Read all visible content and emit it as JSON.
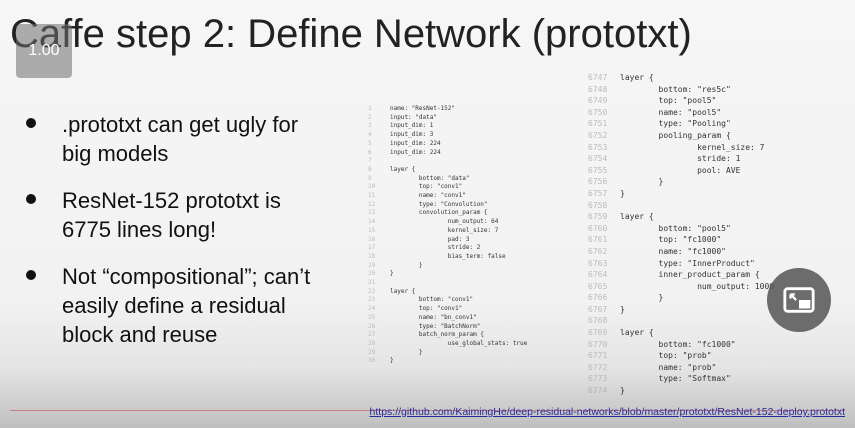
{
  "title": "Caffe step 2: Define Network (prototxt)",
  "video_overlay": {
    "speed_label": "1.00",
    "pip_icon": "picture-in-picture-icon"
  },
  "bullets": [
    {
      "lines": [
        ".prototxt can get ugly for",
        "big models"
      ]
    },
    {
      "lines": [
        "ResNet-152 prototxt is",
        "6775 lines long!"
      ]
    },
    {
      "lines": [
        "Not “compositional”; can’t",
        "easily define a residual",
        "block and reuse"
      ]
    }
  ],
  "code_left": [
    {
      "n": "1",
      "text": "name: \"ResNet-152\""
    },
    {
      "n": "2",
      "text": "input: \"data\""
    },
    {
      "n": "3",
      "text": "input_dim: 1"
    },
    {
      "n": "4",
      "text": "input_dim: 3"
    },
    {
      "n": "5",
      "text": "input_dim: 224"
    },
    {
      "n": "6",
      "text": "input_dim: 224"
    },
    {
      "n": "7",
      "text": ""
    },
    {
      "n": "8",
      "text": "layer {"
    },
    {
      "n": "9",
      "text": "        bottom: \"data\""
    },
    {
      "n": "10",
      "text": "        top: \"conv1\""
    },
    {
      "n": "11",
      "text": "        name: \"conv1\""
    },
    {
      "n": "12",
      "text": "        type: \"Convolution\""
    },
    {
      "n": "13",
      "text": "        convolution_param {"
    },
    {
      "n": "14",
      "text": "                num_output: 64"
    },
    {
      "n": "15",
      "text": "                kernel_size: 7"
    },
    {
      "n": "16",
      "text": "                pad: 3"
    },
    {
      "n": "17",
      "text": "                stride: 2"
    },
    {
      "n": "18",
      "text": "                bias_term: false"
    },
    {
      "n": "19",
      "text": "        }"
    },
    {
      "n": "20",
      "text": "}"
    },
    {
      "n": "21",
      "text": ""
    },
    {
      "n": "22",
      "text": "layer {"
    },
    {
      "n": "23",
      "text": "        bottom: \"conv1\""
    },
    {
      "n": "24",
      "text": "        top: \"conv1\""
    },
    {
      "n": "25",
      "text": "        name: \"bn_conv1\""
    },
    {
      "n": "26",
      "text": "        type: \"BatchNorm\""
    },
    {
      "n": "27",
      "text": "        batch_norm_param {"
    },
    {
      "n": "28",
      "text": "                use_global_stats: true"
    },
    {
      "n": "29",
      "text": "        }"
    },
    {
      "n": "30",
      "text": "}"
    }
  ],
  "code_right": [
    {
      "n": "6747",
      "text": "layer {"
    },
    {
      "n": "6748",
      "text": "        bottom: \"res5c\""
    },
    {
      "n": "6749",
      "text": "        top: \"pool5\""
    },
    {
      "n": "6750",
      "text": "        name: \"pool5\""
    },
    {
      "n": "6751",
      "text": "        type: \"Pooling\""
    },
    {
      "n": "6752",
      "text": "        pooling_param {"
    },
    {
      "n": "6753",
      "text": "                kernel_size: 7"
    },
    {
      "n": "6754",
      "text": "                stride: 1"
    },
    {
      "n": "6755",
      "text": "                pool: AVE"
    },
    {
      "n": "6756",
      "text": "        }"
    },
    {
      "n": "6757",
      "text": "}"
    },
    {
      "n": "6758",
      "text": ""
    },
    {
      "n": "6759",
      "text": "layer {"
    },
    {
      "n": "6760",
      "text": "        bottom: \"pool5\""
    },
    {
      "n": "6761",
      "text": "        top: \"fc1000\""
    },
    {
      "n": "6762",
      "text": "        name: \"fc1000\""
    },
    {
      "n": "6763",
      "text": "        type: \"InnerProduct\""
    },
    {
      "n": "6764",
      "text": "        inner_product_param {"
    },
    {
      "n": "6765",
      "text": "                num_output: 1000"
    },
    {
      "n": "6766",
      "text": "        }"
    },
    {
      "n": "6767",
      "text": "}"
    },
    {
      "n": "6768",
      "text": ""
    },
    {
      "n": "6769",
      "text": "layer {"
    },
    {
      "n": "6770",
      "text": "        bottom: \"fc1000\""
    },
    {
      "n": "6771",
      "text": "        top: \"prob\""
    },
    {
      "n": "6772",
      "text": "        name: \"prob\""
    },
    {
      "n": "6773",
      "text": "        type: \"Softmax\""
    },
    {
      "n": "6774",
      "text": "}"
    }
  ],
  "source_link": "https://github.com/KaimingHe/deep-residual-networks/blob/master/prototxt/ResNet-152-deploy.prototxt"
}
